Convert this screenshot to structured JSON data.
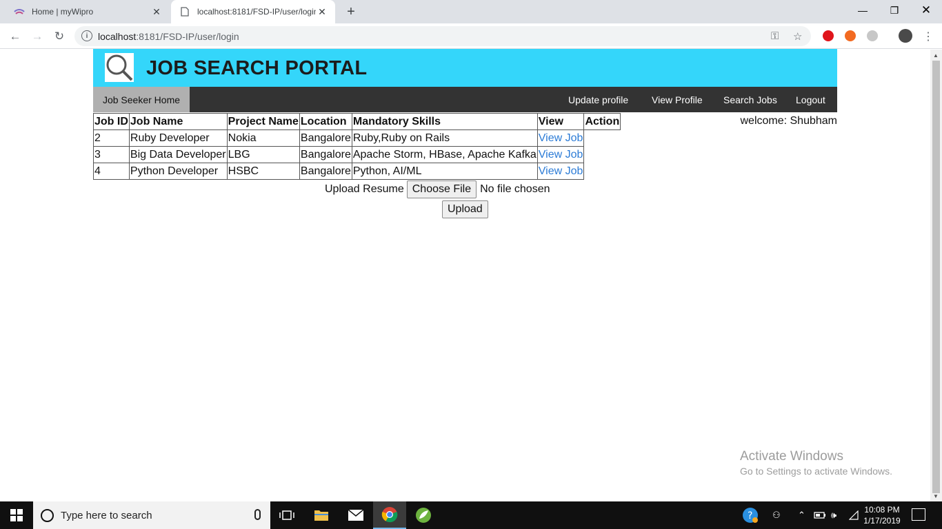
{
  "browser": {
    "tabs": [
      {
        "title": "Home | myWipro",
        "active": false
      },
      {
        "title": "localhost:8181/FSD-IP/user/login",
        "active": true
      }
    ],
    "url_host": "localhost",
    "url_path": ":8181/FSD-IP/user/login"
  },
  "header": {
    "title": "JOB SEARCH PORTAL",
    "logo_icon": "magnifier-icon",
    "background": "#34d6fa"
  },
  "nav": {
    "home": "Job Seeker Home",
    "links": [
      "Update profile",
      "View Profile",
      "Search Jobs",
      "Logout"
    ]
  },
  "welcome": "welcome: Shubham",
  "table": {
    "headers": [
      "Job ID",
      "Job Name",
      "Project Name",
      "Location",
      "Mandatory Skills",
      "View",
      "Action"
    ],
    "rows": [
      [
        "2",
        "Ruby Developer",
        "Nokia",
        "Bangalore",
        "Ruby,Ruby on Rails",
        "View Job"
      ],
      [
        "3",
        "Big Data Developer",
        "LBG",
        "Bangalore",
        "Apache Storm, HBase, Apache Kafka",
        "View Job"
      ],
      [
        "4",
        "Python Developer",
        "HSBC",
        "Bangalore",
        "Python, AI/ML",
        "View Job"
      ]
    ]
  },
  "upload": {
    "label": "Upload Resume",
    "choose": "Choose File",
    "status": "No file chosen",
    "button": "Upload"
  },
  "watermark": {
    "line1": "Activate Windows",
    "line2": "Go to Settings to activate Windows."
  },
  "taskbar": {
    "search_placeholder": "Type here to search",
    "time": "10:08 PM",
    "date": "1/17/2019"
  }
}
